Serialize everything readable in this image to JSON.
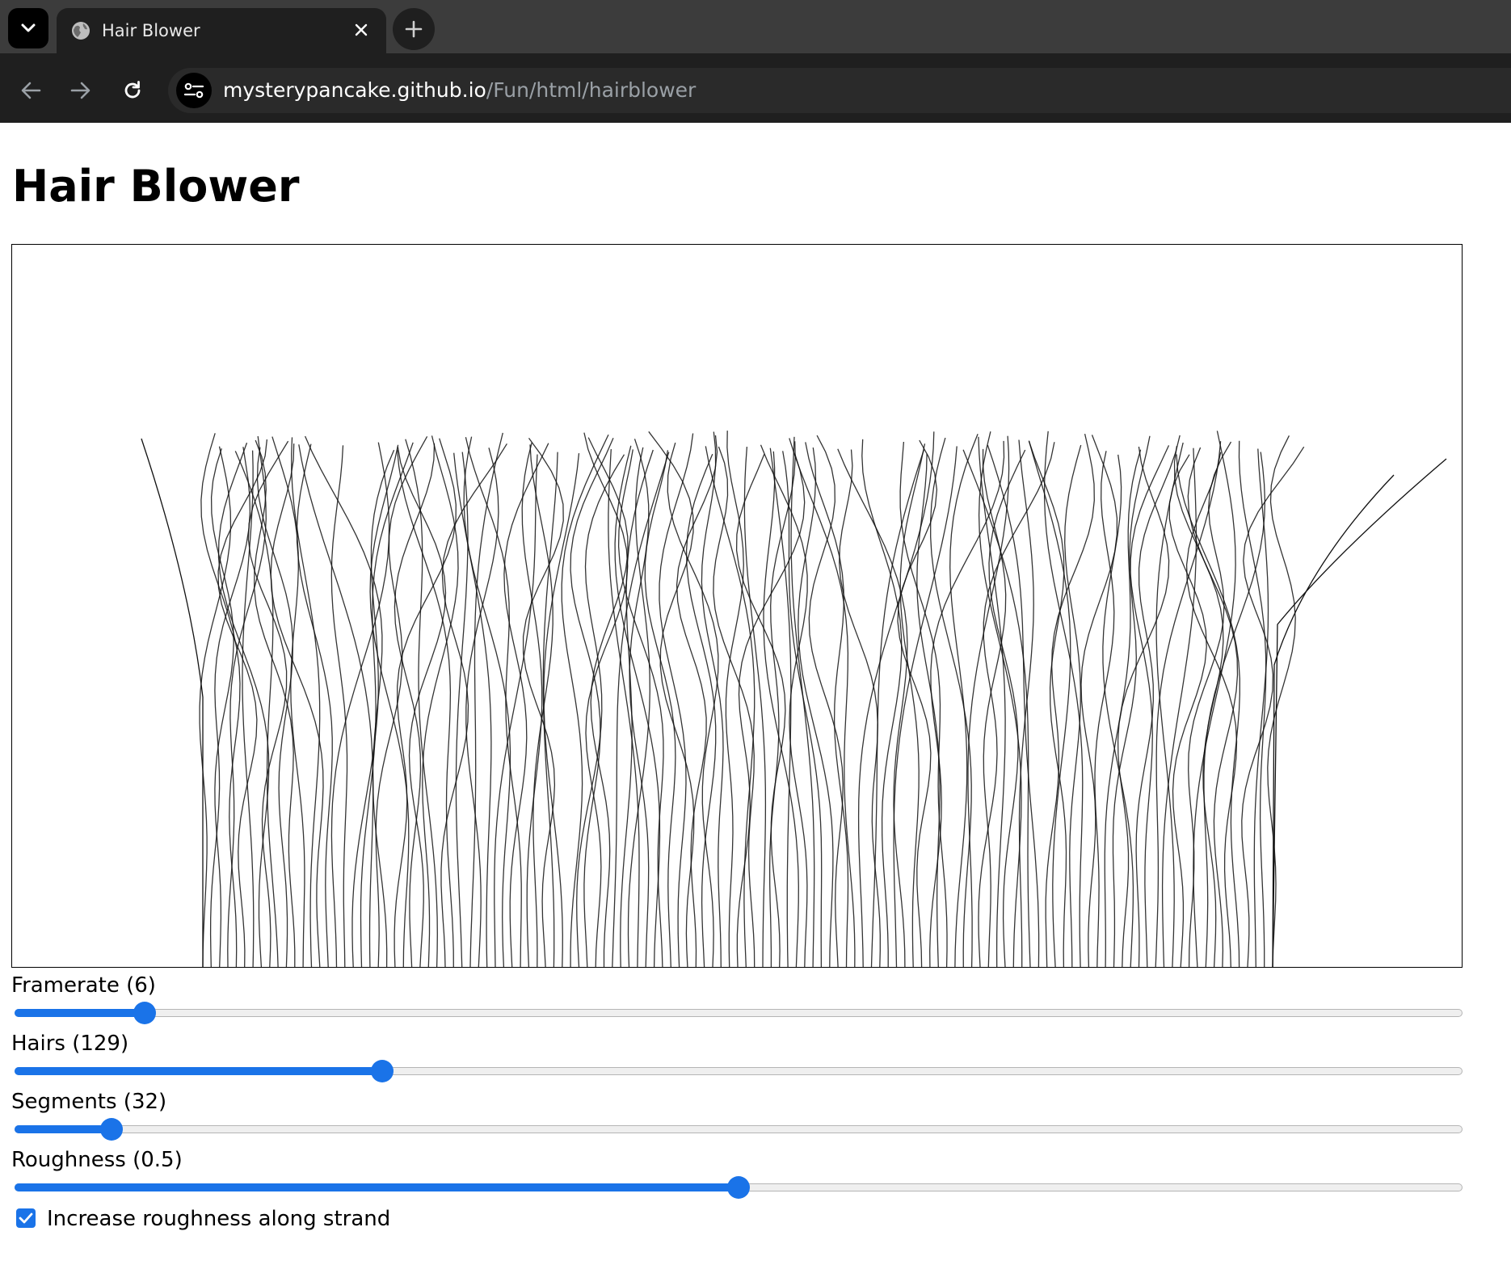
{
  "browser": {
    "tab_title": "Hair Blower",
    "url_host": "mysterypancake.github.io",
    "url_path": "/Fun/html/hairblower"
  },
  "page": {
    "title": "Hair Blower"
  },
  "controls": [
    {
      "label": "Framerate (6)",
      "fraction": 0.09
    },
    {
      "label": "Hairs (129)",
      "fraction": 0.254
    },
    {
      "label": "Segments (32)",
      "fraction": 0.067
    },
    {
      "label": "Roughness (0.5)",
      "fraction": 0.5
    }
  ],
  "checkbox": {
    "label": "Increase roughness along strand",
    "checked": true
  },
  "colors": {
    "accent": "#1a73e8",
    "hair": "#111111"
  }
}
